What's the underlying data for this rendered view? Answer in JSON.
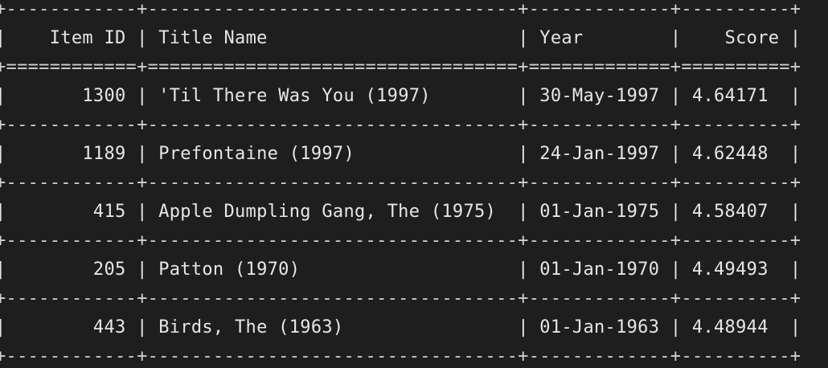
{
  "table": {
    "headers": [
      "Item ID",
      "Title Name",
      "Year",
      "Score"
    ],
    "rows": [
      {
        "item_id": "1300",
        "title": "'Til There Was You (1997)",
        "year": "30-May-1997",
        "score": "4.64171"
      },
      {
        "item_id": "1189",
        "title": "Prefontaine (1997)",
        "year": "24-Jan-1997",
        "score": "4.62448"
      },
      {
        "item_id": "415",
        "title": "Apple Dumpling Gang, The (1975)",
        "year": "01-Jan-1975",
        "score": "4.58407"
      },
      {
        "item_id": "205",
        "title": "Patton (1970)",
        "year": "01-Jan-1970",
        "score": "4.49493"
      },
      {
        "item_id": "443",
        "title": "Birds, The (1963)",
        "year": "01-Jan-1963",
        "score": "4.48944"
      }
    ]
  }
}
